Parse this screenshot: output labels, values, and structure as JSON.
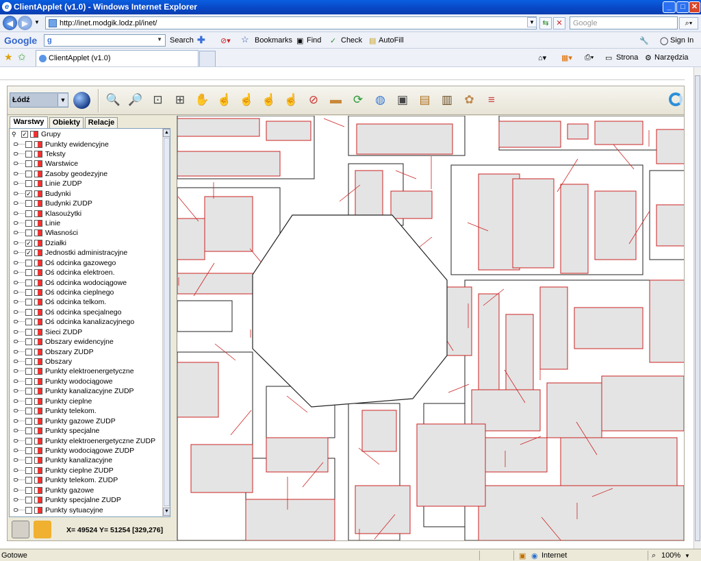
{
  "window": {
    "title": "ClientApplet (v1.0) - Windows Internet Explorer"
  },
  "address": {
    "url": "http://inet.modgik.lodz.pl/inet/",
    "search_placeholder": "Google"
  },
  "google_bar": {
    "logo": "Google",
    "input": "g",
    "items": [
      "Search",
      "Bookmarks",
      "Find",
      "Check",
      "AutoFill"
    ],
    "sign_in": "Sign In"
  },
  "tabs": {
    "active": "ClientApplet (v1.0)",
    "right": [
      "Strona",
      "Narzędzia"
    ]
  },
  "applet": {
    "city": "Łódź",
    "panel_tabs": [
      "Warstwy",
      "Obiekty",
      "Relacje"
    ],
    "tree_root": "Grupy",
    "layers": [
      {
        "name": "Punkty ewidencyjne",
        "checked": false
      },
      {
        "name": "Teksty",
        "checked": false
      },
      {
        "name": "Warstwice",
        "checked": false
      },
      {
        "name": "Zasoby geodezyjne",
        "checked": false
      },
      {
        "name": "Linie ZUDP",
        "checked": false
      },
      {
        "name": "Budynki",
        "checked": true
      },
      {
        "name": "Budynki ZUDP",
        "checked": false
      },
      {
        "name": "Klasoużytki",
        "checked": false
      },
      {
        "name": "Linie",
        "checked": false
      },
      {
        "name": "Własności",
        "checked": false
      },
      {
        "name": "Działki",
        "checked": true
      },
      {
        "name": "Jednostki administracyjne",
        "checked": true
      },
      {
        "name": "Oś odcinka gazowego",
        "checked": false
      },
      {
        "name": "Oś odcinka elektroen.",
        "checked": false
      },
      {
        "name": "Oś odcinka wodociągowe",
        "checked": false
      },
      {
        "name": "Oś odcinka cieplnego",
        "checked": false
      },
      {
        "name": "Oś odcinka telkom.",
        "checked": false
      },
      {
        "name": "Oś odcinka specjalnego",
        "checked": false
      },
      {
        "name": "Oś odcinka kanalizacyjnego",
        "checked": false
      },
      {
        "name": "Sieci ZUDP",
        "checked": false
      },
      {
        "name": "Obszary ewidencyjne",
        "checked": false
      },
      {
        "name": "Obszary ZUDP",
        "checked": false
      },
      {
        "name": "Obszary",
        "checked": false
      },
      {
        "name": "Punkty elektroenergetyczne",
        "checked": false
      },
      {
        "name": "Punkty wodociągowe",
        "checked": false
      },
      {
        "name": "Punkty kanalizacyjne ZUDP",
        "checked": false
      },
      {
        "name": "Punkty cieplne",
        "checked": false
      },
      {
        "name": "Punkty telekom.",
        "checked": false
      },
      {
        "name": "Punkty gazowe ZUDP",
        "checked": false
      },
      {
        "name": "Punkty specjalne",
        "checked": false
      },
      {
        "name": "Punkty elektroenergetyczne ZUDP",
        "checked": false
      },
      {
        "name": "Punkty wodociągowe ZUDP",
        "checked": false
      },
      {
        "name": "Punkty kanalizacyjne",
        "checked": false
      },
      {
        "name": "Punkty cieplne ZUDP",
        "checked": false
      },
      {
        "name": "Punkty telekom. ZUDP",
        "checked": false
      },
      {
        "name": "Punkty gazowe",
        "checked": false
      },
      {
        "name": "Punkty specjalne ZUDP",
        "checked": false
      },
      {
        "name": "Punkty sytuacyjne",
        "checked": false
      }
    ],
    "coords": "X= 49524 Y= 51254 [329,276]",
    "tools": [
      "zoom-out-icon",
      "zoom-in-icon",
      "zoom-extent-icon",
      "zoom-window-icon",
      "pan-hand-icon",
      "select-hand-icon",
      "info-hand-icon",
      "edit-hand-icon",
      "select-area-icon",
      "link-icon",
      "measure-ruler-icon",
      "refresh-icon",
      "map-icon",
      "print-icon",
      "export-icon",
      "layer-icon",
      "settings-icon",
      "legend-icon"
    ]
  },
  "statusbar": {
    "left": "Gotowe",
    "zone": "Internet",
    "zoom": "100%"
  },
  "colors": {
    "parcel_line": "#cc2222",
    "building_fill": "#e4e4e4",
    "accent": "#0a5fe0"
  }
}
